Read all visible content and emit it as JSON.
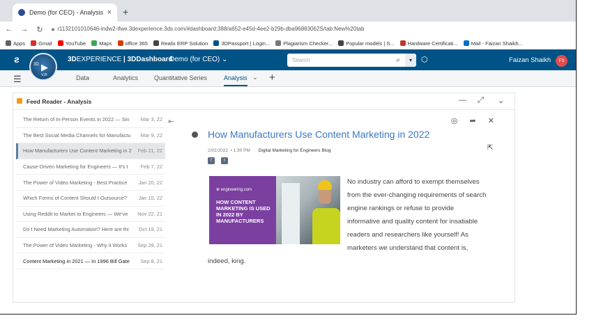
{
  "browser": {
    "tab_title": "Demo (for CEO) - Analysis",
    "tab_close": "×",
    "new_tab": "+",
    "url": "r1132101010646-indw2-ifwe.3dexperience.3ds.com/#dashboard:388/a652-e45d-4ee2-b29b-dba96883062S/tab:New%20tab",
    "bookmarks": [
      {
        "label": "Apps",
        "color": "#5f6368"
      },
      {
        "label": "Gmail",
        "color": "#d93025"
      },
      {
        "label": "YouTube",
        "color": "#ff0000"
      },
      {
        "label": "Maps",
        "color": "#34a853"
      },
      {
        "label": "office 365",
        "color": "#d83b01"
      },
      {
        "label": "Realix ERP Solution",
        "color": "#444444"
      },
      {
        "label": "3DPassport | Login...",
        "color": "#005386"
      },
      {
        "label": "Plagiarism Checker...",
        "color": "#777777"
      },
      {
        "label": "Popular models | S...",
        "color": "#444444"
      },
      {
        "label": "Hardware Certificati...",
        "color": "#c0392b"
      },
      {
        "label": "Mail - Faizan Shaikh...",
        "color": "#0072c6"
      }
    ]
  },
  "app": {
    "compass_3d": "3D",
    "compass_play": "▶",
    "compass_vr": "V,R",
    "brand_prefix": "3D",
    "brand_suffix": "EXPERIENCE",
    "brand_app": "| 3DDashboard",
    "dashboard_title": "Demo (for CEO) ⌄",
    "search_placeholder": "Search",
    "user_name": "Faizan Shaikh",
    "user_initials": "FS",
    "colors": {
      "topbar": "#005386",
      "accent": "#3b79c4",
      "avatar": "#e14d4d"
    }
  },
  "dashboard_tabs": [
    {
      "label": "Data",
      "active": false
    },
    {
      "label": "Analytics",
      "active": false
    },
    {
      "label": "Quantitative Series",
      "active": false
    },
    {
      "label": "Analysis",
      "active": true
    }
  ],
  "widget": {
    "title": "Feed Reader - Analysis",
    "feed_items": [
      {
        "title": "The Return of In-Person Events in 2022 — Sin",
        "date": "Mar 3, 22"
      },
      {
        "title": "The Best Social Media Channels for Manufactu",
        "date": "Mar 9, 22"
      },
      {
        "title": "How Manufacturers Use Content Marketing in 2",
        "date": "Feb 21, 22"
      },
      {
        "title": "Cause-Driven Marketing for Engineers — It's t",
        "date": "Feb 7, 22"
      },
      {
        "title": "The Power of Video Marketing - Best Practice",
        "date": "Jan 20, 22"
      },
      {
        "title": "Which Forms of Content Should I Outsource?",
        "date": "Jan 10, 22"
      },
      {
        "title": "Using Reddit to Market to Engineers — We've",
        "date": "Nov 22, 21"
      },
      {
        "title": "Do I Need Marketing Automation? Here are thi",
        "date": "Oct 19, 21"
      },
      {
        "title": "The Power of Video Marketing - Why it Works",
        "date": "Sep 28, 21"
      },
      {
        "title": "Content Marketing in 2021 — In 1996 Bill Gate",
        "date": "Sep 8, 21"
      }
    ],
    "article": {
      "title": "How Manufacturers Use Content Marketing in 2022",
      "date": "2/01/2022",
      "time": "1:30 PM",
      "source": "Digital Marketing for Engineers Blog",
      "image_site": "⊕ engineering.com",
      "image_headline": "HOW CONTENT MARKETING IS USED IN 2022 BY MANUFACTURERS",
      "body": "No industry can afford to exempt themselves from the ever-changing requirements of search engine rankings or refuse to provide informative and quality content for insatiable readers and researchers like yourself! As marketers we understand that content is, indeed, king."
    }
  }
}
